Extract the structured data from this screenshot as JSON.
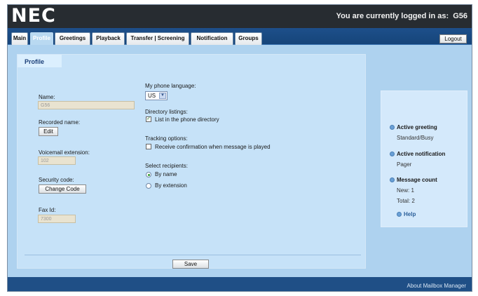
{
  "header": {
    "logo": "NEC",
    "logged_in_label": "You are currently logged in as:",
    "user": "G56"
  },
  "tabs": [
    {
      "label": "Main",
      "active": false
    },
    {
      "label": "Profile",
      "active": true
    },
    {
      "label": "Greetings",
      "active": false
    },
    {
      "label": "Playback",
      "active": false
    },
    {
      "label": "Transfer | Screening",
      "active": false
    },
    {
      "label": "Notification",
      "active": false
    },
    {
      "label": "Groups",
      "active": false
    }
  ],
  "logout_label": "Logout",
  "profile": {
    "panel_title": "Profile",
    "name_label": "Name:",
    "name_value": "G56",
    "recorded_name_label": "Recorded name:",
    "edit_button": "Edit",
    "voicemail_extension_label": "Voicemail extension:",
    "voicemail_extension_value": "102",
    "security_code_label": "Security code:",
    "change_code_button": "Change Code",
    "fax_id_label": "Fax Id:",
    "fax_id_value": "7300",
    "phone_language_label": "My phone language:",
    "phone_language_value": "US",
    "directory_listings_label": "Directory listings:",
    "directory_option": "List in the phone directory",
    "directory_checked": true,
    "tracking_options_label": "Tracking options:",
    "tracking_option": "Receive confirmation when message is played",
    "tracking_checked": false,
    "select_recipients_label": "Select recipients:",
    "recipient_options": [
      "By name",
      "By extension"
    ],
    "recipient_selected": "By name",
    "save_button": "Save"
  },
  "status": {
    "active_greeting_label": "Active greeting",
    "active_greeting_value": "Standard/Busy",
    "active_notification_label": "Active notification",
    "active_notification_value": "Pager",
    "message_count_label": "Message count",
    "new_count": "New: 1",
    "total_count": "Total: 2",
    "help_label": "Help"
  },
  "footer": {
    "about_label": "About Mailbox Manager"
  }
}
